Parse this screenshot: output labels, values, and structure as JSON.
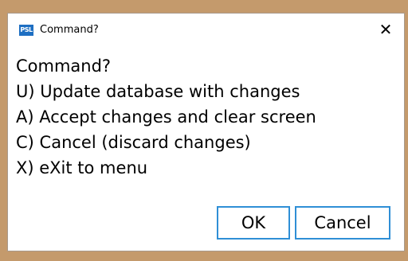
{
  "window": {
    "title": "Command?",
    "icon_label": "PSL",
    "close_glyph": "✕"
  },
  "message": {
    "heading": "Command?",
    "options": [
      "U) Update database with changes",
      "A) Accept changes and clear screen",
      "C) Cancel (discard changes)",
      "X) eXit to menu"
    ]
  },
  "buttons": {
    "ok_label": "OK",
    "cancel_label": "Cancel"
  },
  "colors": {
    "background": "#c49a6c",
    "accent": "#2f8fd6",
    "icon": "#1e6fc2"
  }
}
